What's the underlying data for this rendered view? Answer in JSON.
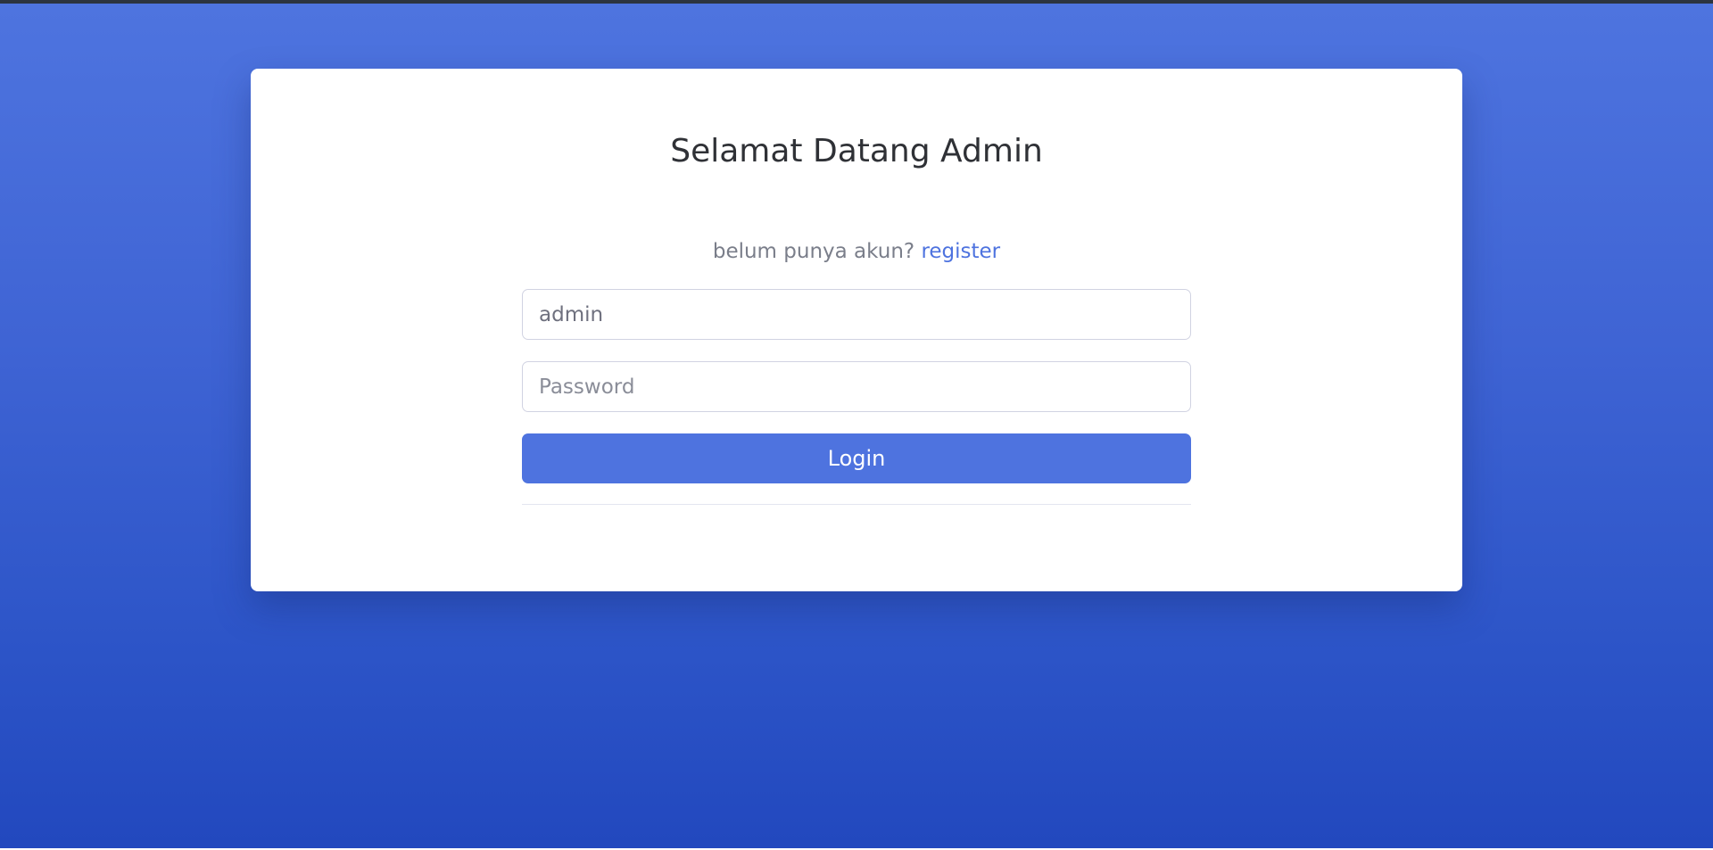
{
  "page": {
    "title": "Selamat Datang Admin",
    "register_prompt": "belum punya akun?",
    "register_link": "register"
  },
  "form": {
    "username_value": "admin",
    "username_placeholder": "",
    "password_value": "",
    "password_placeholder": "Password",
    "login_label": "Login"
  },
  "colors": {
    "primary": "#4e73df",
    "background_top": "#4e74df",
    "background_bottom": "#2248be",
    "title_text": "#2f3136",
    "muted_text": "#7a7e8a",
    "input_border": "#d1d3e2"
  }
}
